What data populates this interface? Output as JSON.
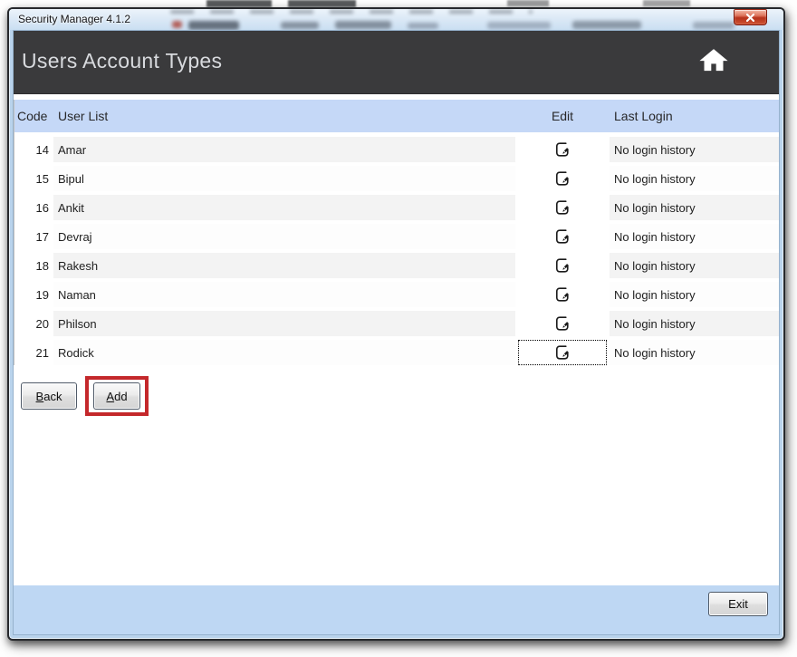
{
  "window": {
    "title": "Security Manager 4.1.2",
    "close_icon": "close-icon"
  },
  "header": {
    "title": "Users Account Types",
    "home_icon": "home-icon"
  },
  "table": {
    "headers": {
      "code": "Code",
      "user": "User List",
      "edit": "Edit",
      "last_login": "Last Login"
    },
    "rows": [
      {
        "code": "14",
        "name": "Amar",
        "last_login": "No login history"
      },
      {
        "code": "15",
        "name": "Bipul",
        "last_login": "No login history"
      },
      {
        "code": "16",
        "name": "Ankit",
        "last_login": "No login history"
      },
      {
        "code": "17",
        "name": "Devraj",
        "last_login": "No login history"
      },
      {
        "code": "18",
        "name": "Rakesh",
        "last_login": "No login history"
      },
      {
        "code": "19",
        "name": "Naman",
        "last_login": "No login history"
      },
      {
        "code": "20",
        "name": "Philson",
        "last_login": "No login history"
      },
      {
        "code": "21",
        "name": "Rodick",
        "last_login": "No login history"
      }
    ],
    "edit_icon": "edit-icon"
  },
  "buttons": {
    "back": "Back",
    "add": "Add",
    "exit": "Exit"
  },
  "colors": {
    "table_header_bg": "#c5d8f7",
    "footer_bg": "#bed7f3",
    "dark_header_bg": "#3a3a3c",
    "row_alt_bg": "#f3f3f3",
    "annotation_red": "#c4282b",
    "close_button_red": "#b5331c",
    "frame_glass": "#b9d3ec"
  }
}
